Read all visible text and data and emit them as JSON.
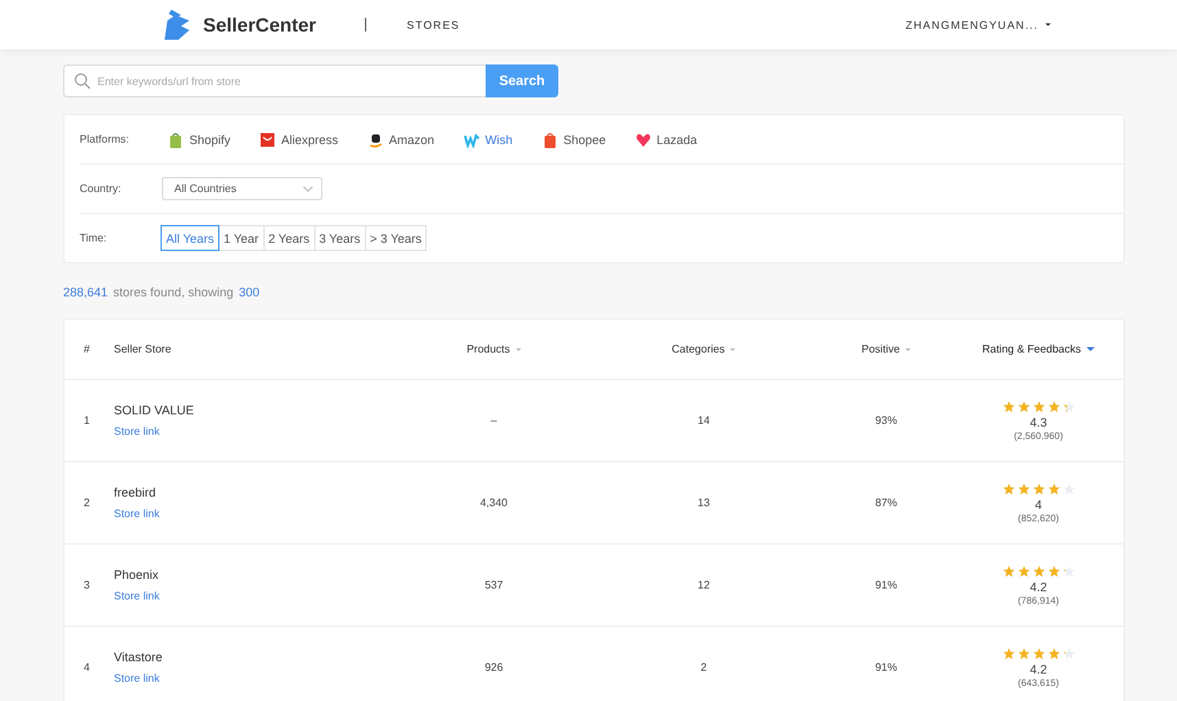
{
  "header": {
    "brand": "SellerCenter",
    "section": "STORES",
    "user": "ZHANGMENGYUAN..."
  },
  "search": {
    "placeholder": "Enter keywords/url from store",
    "button": "Search"
  },
  "filters": {
    "platforms_label": "Platforms:",
    "platforms": [
      {
        "label": "Shopify",
        "selected": false
      },
      {
        "label": "Aliexpress",
        "selected": false
      },
      {
        "label": "Amazon",
        "selected": false
      },
      {
        "label": "Wish",
        "selected": true
      },
      {
        "label": "Shopee",
        "selected": false
      },
      {
        "label": "Lazada",
        "selected": false
      }
    ],
    "country_label": "Country:",
    "country": "All Countries",
    "time_label": "Time:",
    "times": [
      {
        "label": "All Years",
        "selected": true
      },
      {
        "label": "1 Year",
        "selected": false
      },
      {
        "label": "2 Years",
        "selected": false
      },
      {
        "label": "3 Years",
        "selected": false
      },
      {
        "label": "> 3 Years",
        "selected": false
      }
    ]
  },
  "summary": {
    "count": "288,641",
    "text": "stores found, showing",
    "showing": "300"
  },
  "table": {
    "columns": [
      {
        "label": "#",
        "sortable": false
      },
      {
        "label": "Seller Store",
        "sortable": false
      },
      {
        "label": "Products",
        "sortable": true,
        "selected": false
      },
      {
        "label": "Categories",
        "sortable": true,
        "selected": false
      },
      {
        "label": "Positive",
        "sortable": true,
        "selected": false
      },
      {
        "label": "Rating & Feedbacks",
        "sortable": true,
        "selected": true
      }
    ],
    "rows": [
      {
        "rank": "1",
        "name": "SOLID VALUE",
        "link": "Store link",
        "products": "–",
        "categories": "14",
        "positive": "93%",
        "stars": 4.3,
        "rating": "4.3",
        "feedbacks": "(2,560,960)"
      },
      {
        "rank": "2",
        "name": "freebird",
        "link": "Store link",
        "products": "4,340",
        "categories": "13",
        "positive": "87%",
        "stars": 4,
        "rating": "4",
        "feedbacks": "(852,620)"
      },
      {
        "rank": "3",
        "name": "Phoenix",
        "link": "Store link",
        "products": "537",
        "categories": "12",
        "positive": "91%",
        "stars": 4.2,
        "rating": "4.2",
        "feedbacks": "(786,914)"
      },
      {
        "rank": "4",
        "name": "Vitastore",
        "link": "Store link",
        "products": "926",
        "categories": "2",
        "positive": "91%",
        "stars": 4.2,
        "rating": "4.2",
        "feedbacks": "(643,615)"
      }
    ]
  }
}
